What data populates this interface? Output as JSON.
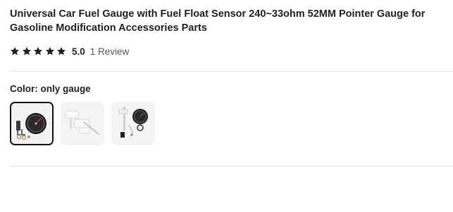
{
  "product": {
    "title": "Universal Car Fuel Gauge with Fuel Float Sensor 240~33ohm 52MM Pointer Gauge for Gasoline Modification Accessories Parts"
  },
  "rating": {
    "stars": 5,
    "max_stars": 5,
    "value": "5.0",
    "reviews_label": "1 Review"
  },
  "color": {
    "label": "Color:",
    "selected": "only gauge",
    "swatches": [
      {
        "icon": "gauge-with-brackets",
        "selected": true
      },
      {
        "icon": "float-sensor-arm",
        "selected": false
      },
      {
        "icon": "gauge-with-float-sensor",
        "selected": false
      }
    ]
  },
  "colors": {
    "star": "#222222",
    "text": "#222222",
    "muted": "#555555",
    "divider": "#e5e5e5",
    "selected_border": "#111111"
  }
}
